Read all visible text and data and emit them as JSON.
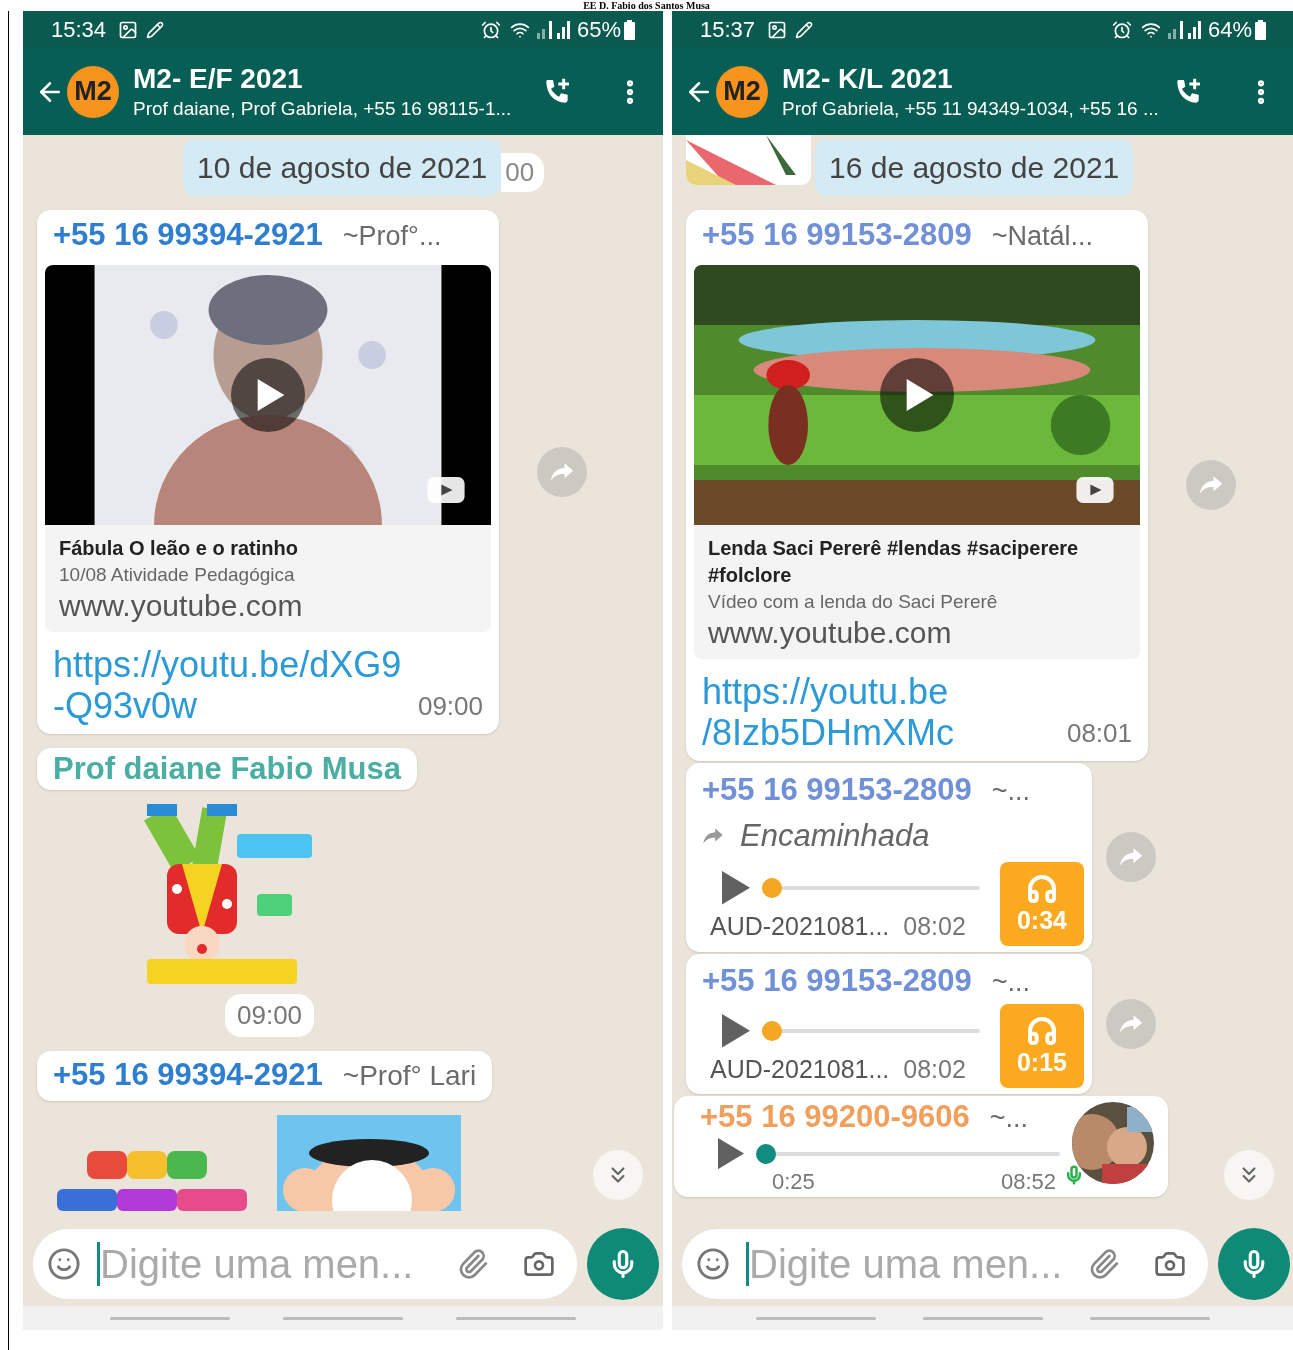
{
  "page_title": "EE D. Fabio dos Santos Musa",
  "phones": [
    {
      "status_bar": {
        "time": "15:34",
        "battery": "65%"
      },
      "header": {
        "avatar": "M2",
        "title": "M2- E/F 2021",
        "subtitle": "Prof daiane, Prof Gabriela, +55 16 98115-1..."
      },
      "top_sticker": false,
      "date_chip": {
        "text": "10 de agosto de 2021",
        "peek": "00"
      },
      "messages": [
        {
          "kind": "link",
          "sender": "+55 16 99394-2921",
          "alias": "~Prof°...",
          "color": "#2f7fd0",
          "title": "Fábula O leão e o ratinho",
          "description": "10/08 Atividade Pedagógica",
          "domain": "www.youtube.com",
          "link_lines": [
            "https://youtu.be/dXG9",
            "-Q93v0w"
          ],
          "time": "09:00",
          "forward": true
        },
        {
          "kind": "sender",
          "sender": "Prof daiane Fabio Musa",
          "color": "#4aaea2"
        },
        {
          "kind": "sticker",
          "time": "09:00"
        },
        {
          "kind": "sender",
          "sender": "+55 16 99394-2921",
          "alias": "~Prof° Lari",
          "color": "#2f7fd0"
        },
        {
          "kind": "stickers"
        }
      ],
      "composer": {
        "placeholder": "Digite uma men..."
      }
    },
    {
      "status_bar": {
        "time": "15:37",
        "battery": "64%"
      },
      "header": {
        "avatar": "M2",
        "title": "M2- K/L 2021",
        "subtitle": "Prof Gabriela, +55 11 94349-1034, +55 16 ..."
      },
      "top_sticker": true,
      "date_chip": {
        "text": "16 de agosto de 2021"
      },
      "messages": [
        {
          "kind": "link",
          "sender": "+55 16 99153-2809",
          "alias": "~Natál...",
          "color": "#7090d8",
          "title": "Lenda Saci Pererê #lendas #saciperere #folclore",
          "description": "Vídeo com a lenda do Saci Pererê",
          "domain": "www.youtube.com",
          "link_lines": [
            "https://youtu.be",
            "/8Izb5DHmXMc"
          ],
          "time": "08:01",
          "forward": true
        },
        {
          "kind": "audio",
          "sender": "+55 16 99153-2809",
          "alias": "~...",
          "color": "#7090d8",
          "forwarded": "Encaminhada",
          "level": 0,
          "file": "AUD-2021081...",
          "time": "08:02",
          "duration": "0:34",
          "forward": true
        },
        {
          "kind": "audio",
          "sender": "+55 16 99153-2809",
          "alias": "~...",
          "color": "#7090d8",
          "level": 0,
          "file": "AUD-2021081...",
          "time": "08:02",
          "duration": "0:15",
          "forward": true
        },
        {
          "kind": "voice",
          "sender": "+55 16 99200-9606",
          "alias": "~...",
          "color": "#f0a05c",
          "level": 0,
          "duration": "0:25",
          "time": "08:52"
        }
      ],
      "composer": {
        "placeholder": "Digite uma men..."
      }
    }
  ]
}
